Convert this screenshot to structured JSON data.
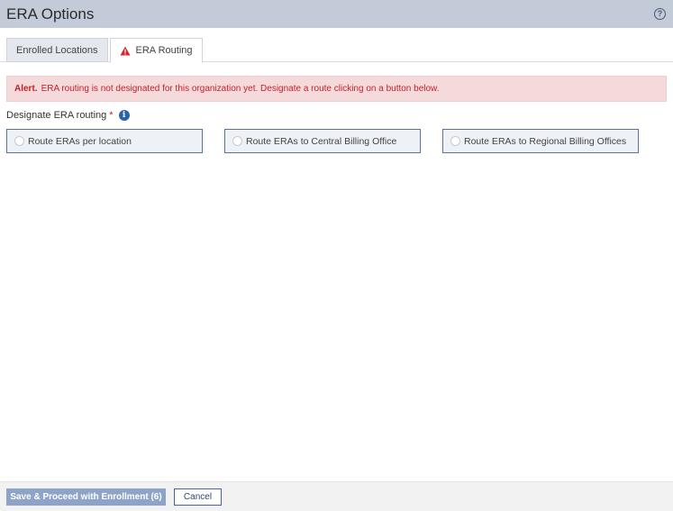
{
  "header": {
    "title": "ERA Options",
    "help_icon_glyph": "?"
  },
  "tabs": [
    {
      "label": "Enrolled Locations",
      "active": false
    },
    {
      "label": "ERA Routing",
      "active": true,
      "icon": "warning-triangle-icon"
    }
  ],
  "alert": {
    "strong": "Alert.",
    "message": "ERA routing is not designated for this organization yet. Designate a route clicking on a button below."
  },
  "routing": {
    "label": "Designate ERA routing",
    "required_mark": "*",
    "info_glyph": "i",
    "options": [
      {
        "label": "Route ERAs per location"
      },
      {
        "label": "Route ERAs to Central Billing Office"
      },
      {
        "label": "Route ERAs to Regional Billing Offices"
      }
    ]
  },
  "footer": {
    "primary_label": "Save & Proceed with Enrollment (6)",
    "cancel_label": "Cancel"
  },
  "colors": {
    "header_bg": "#c3cbd9",
    "alert_bg": "#f4dadb",
    "alert_text": "#c8202a",
    "option_border": "#5b7396",
    "primary_button_bg": "#8da4c8"
  }
}
